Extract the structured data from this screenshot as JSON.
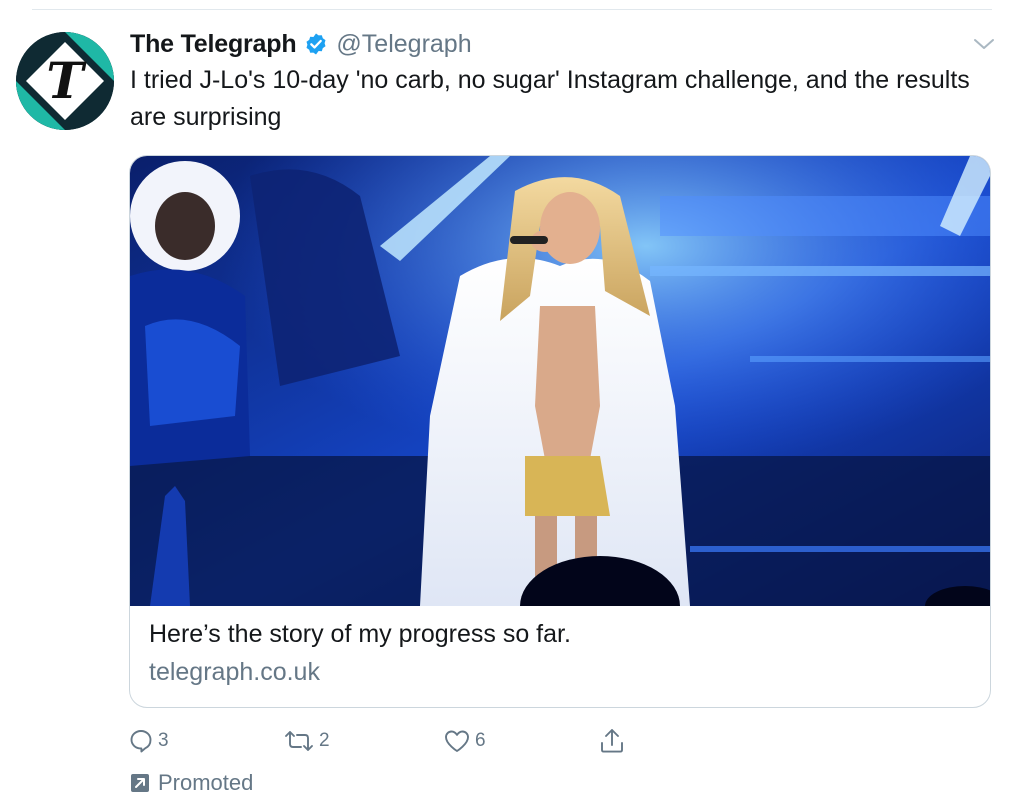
{
  "tweet": {
    "display_name": "The Telegraph",
    "handle": "@Telegraph",
    "verified": true,
    "text": "I tried J-Lo's 10-day 'no carb, no sugar' Instagram challenge, and the results are surprising"
  },
  "card": {
    "image_icon": "performer-on-stage-photo",
    "title": "Here’s the story of my progress so far.",
    "domain": "telegraph.co.uk"
  },
  "actions": {
    "reply_count": "3",
    "retweet_count": "2",
    "like_count": "6"
  },
  "promoted": {
    "label": "Promoted"
  },
  "colors": {
    "text": "#14171a",
    "secondary": "#657786",
    "verified": "#1da1f2",
    "border": "#ccd6dd",
    "avatar_accent": "#1fb8a6"
  }
}
